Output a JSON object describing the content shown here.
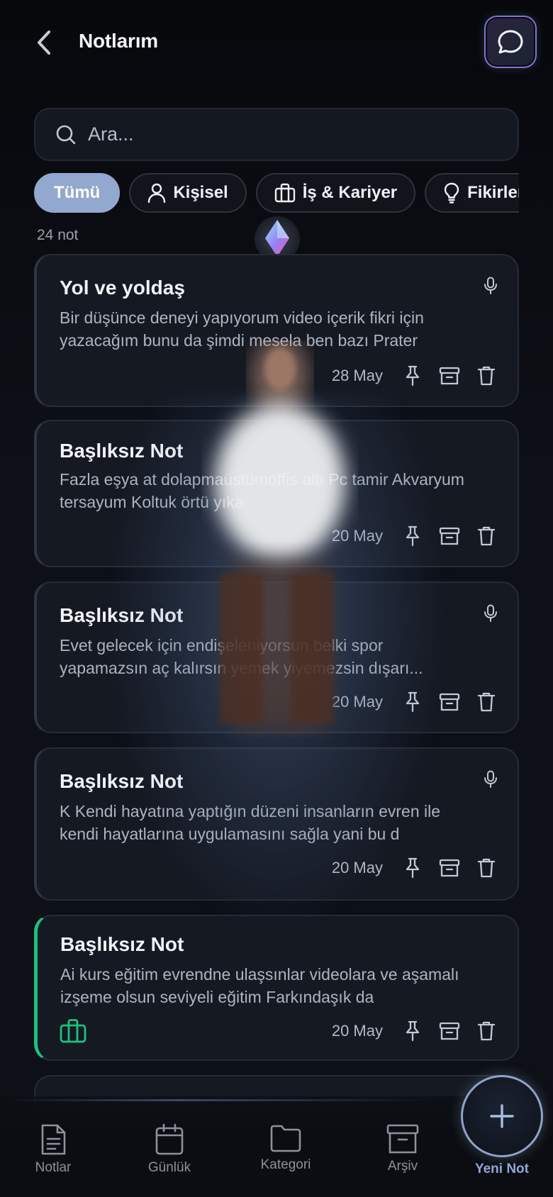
{
  "header": {
    "title": "Notlarım"
  },
  "search": {
    "placeholder": "Ara..."
  },
  "chips": [
    {
      "label": "Tümü",
      "icon": "none"
    },
    {
      "label": "Kişisel",
      "icon": "person-icon"
    },
    {
      "label": "İş & Kariyer",
      "icon": "briefcase-icon"
    },
    {
      "label": "Fikirler",
      "icon": "lightbulb-icon"
    }
  ],
  "count": "24 not",
  "notes": [
    {
      "title": "Yol ve yoldaş",
      "line1": "Bir düşünce deneyi yapıyorum video içerik fikri için",
      "line2": "yazacağım bunu da şimdi mesela ben bazı Prater",
      "date": "28 May",
      "has_mic": true
    },
    {
      "title": "Başlıksız Not",
      "line1": "Fazla eşya at dolapmaüstümoffis altı Pc tamir Akvaryum",
      "line2": "tersayum Koltuk örtü yıka",
      "date": "20 May",
      "has_mic": false
    },
    {
      "title": "Başlıksız Not",
      "line1": "Evet gelecek için endişeleniyorsun belki spor",
      "line2": "yapamazsın aç kalırsın yemek yiyemezsin dışarı...",
      "date": "20 May",
      "has_mic": true
    },
    {
      "title": "Başlıksız Not",
      "line1": "K Kendi hayatına yaptığın düzeni insanların evren ile",
      "line2": "kendi hayatlarına uygulamasını sağla yani bu d",
      "date": "20 May",
      "has_mic": true
    },
    {
      "title": "Başlıksız Not",
      "line1": "Ai kurs eğitim evrendne ulaşsınlar videolara ve aşamalı",
      "line2": "izşeme olsun seviyeli eğitim Farkındaşık da",
      "date": "20 May",
      "has_mic": false,
      "category_icon": "briefcase-icon"
    }
  ],
  "nav": [
    {
      "label": "Notlar",
      "icon": "document-icon"
    },
    {
      "label": "Günlük",
      "icon": "calendar-icon"
    },
    {
      "label": "Kategori",
      "icon": "folder-icon"
    },
    {
      "label": "Arşiv",
      "icon": "archive-icon"
    }
  ],
  "fab": {
    "label": "Yeni Not",
    "icon": "plus-icon"
  },
  "colors": {
    "accent_chip": "#93a8cf",
    "green_accent": "#19c37d",
    "fab_ring": "#8fa3c6"
  }
}
